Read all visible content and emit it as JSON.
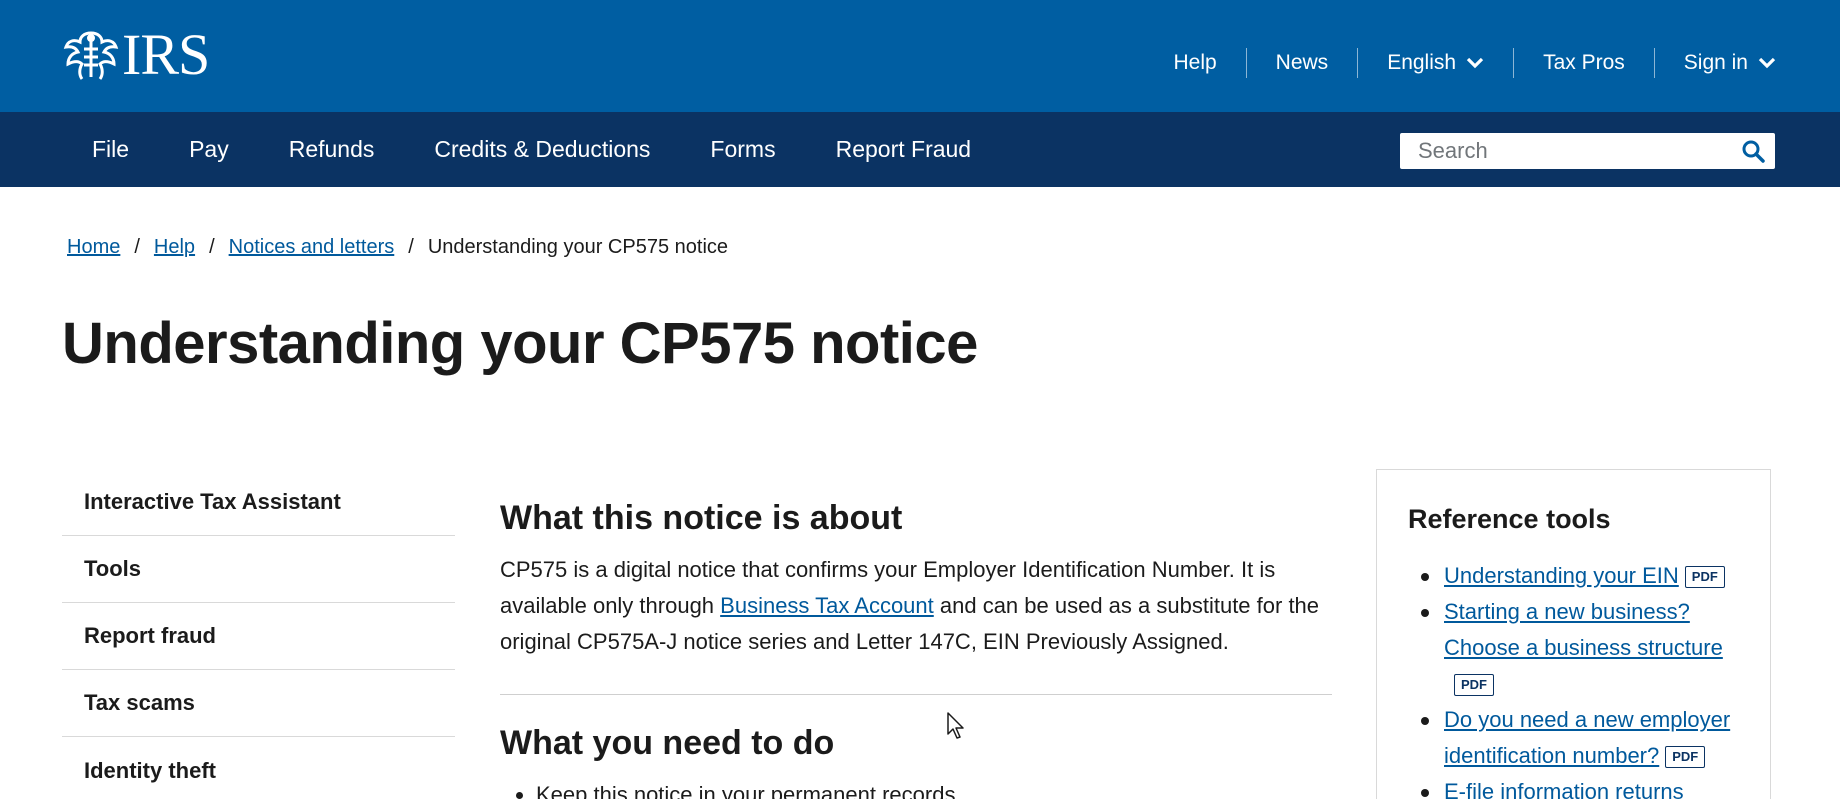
{
  "header": {
    "logo_text": "IRS",
    "utility_nav": [
      {
        "label": "Help",
        "dropdown": false
      },
      {
        "label": "News",
        "dropdown": false
      },
      {
        "label": "English",
        "dropdown": true
      },
      {
        "label": "Tax Pros",
        "dropdown": false
      },
      {
        "label": "Sign in",
        "dropdown": true
      }
    ]
  },
  "main_nav": {
    "items": [
      "File",
      "Pay",
      "Refunds",
      "Credits & Deductions",
      "Forms",
      "Report Fraud"
    ],
    "search_placeholder": "Search"
  },
  "breadcrumb": {
    "items": [
      "Home",
      "Help",
      "Notices and letters"
    ],
    "current": "Understanding your CP575 notice",
    "separator": "/"
  },
  "page_title": "Understanding your CP575 notice",
  "sidebar": {
    "items": [
      "Interactive Tax Assistant",
      "Tools",
      "Report fraud",
      "Tax scams",
      "Identity theft"
    ]
  },
  "content": {
    "section1_heading": "What this notice is about",
    "section1_text_before": "CP575 is a digital notice that confirms your Employer Identification Number. It is available only through ",
    "section1_link": "Business Tax Account",
    "section1_text_after": " and can be used as a substitute for the original CP575A-J notice series and Letter 147C, EIN Previously Assigned.",
    "section2_heading": "What you need to do",
    "section2_bullets": [
      "Keep this notice in your permanent records"
    ]
  },
  "reference_tools": {
    "title": "Reference tools",
    "pdf_badge": "PDF",
    "links": [
      {
        "label": "Understanding your EIN",
        "pdf": true
      },
      {
        "label": "Starting a new business? Choose a business structure",
        "pdf": true
      },
      {
        "label": "Do you need a new employer identification number?",
        "pdf": true
      },
      {
        "label": "E-file information returns",
        "pdf": false
      }
    ]
  },
  "colors": {
    "header_blue": "#005ea2",
    "nav_navy": "#0b3363",
    "link_blue": "#00599c"
  }
}
